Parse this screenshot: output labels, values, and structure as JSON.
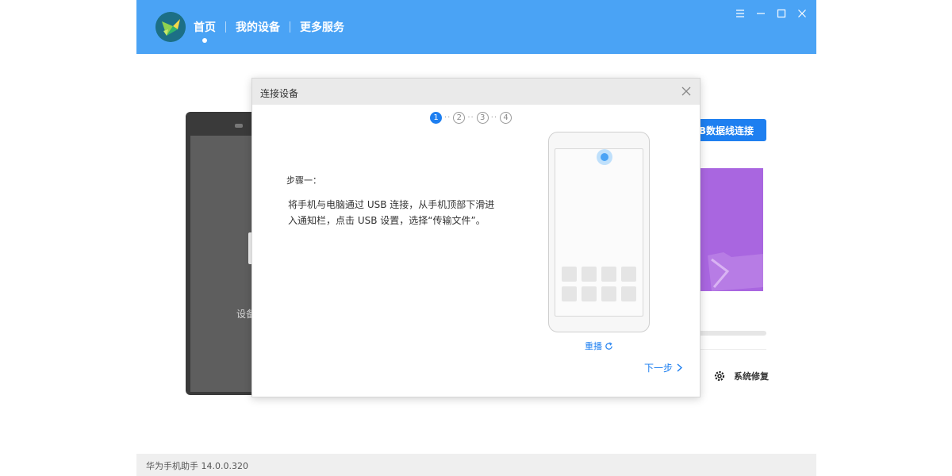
{
  "header": {
    "nav": [
      {
        "label": "首页",
        "active": true
      },
      {
        "label": "我的设备",
        "active": false
      },
      {
        "label": "更多服务",
        "active": false
      }
    ],
    "accent_color": "#4aa3f5"
  },
  "background": {
    "device_label": "设备",
    "usb_button_label": "B数据线连接",
    "repair_label": "系统修复"
  },
  "modal": {
    "title": "连接设备",
    "steps": [
      "1",
      "2",
      "3",
      "4"
    ],
    "active_step": 1,
    "step_heading": "步骤一：",
    "step_text": "将手机与电脑通过 USB 连接，从手机顶部下滑进入通知栏，点击 USB 设置，选择“传输文件”。",
    "replay_label": "重播",
    "next_label": "下一步"
  },
  "footer": {
    "version": "华为手机助手 14.0.0.320"
  }
}
